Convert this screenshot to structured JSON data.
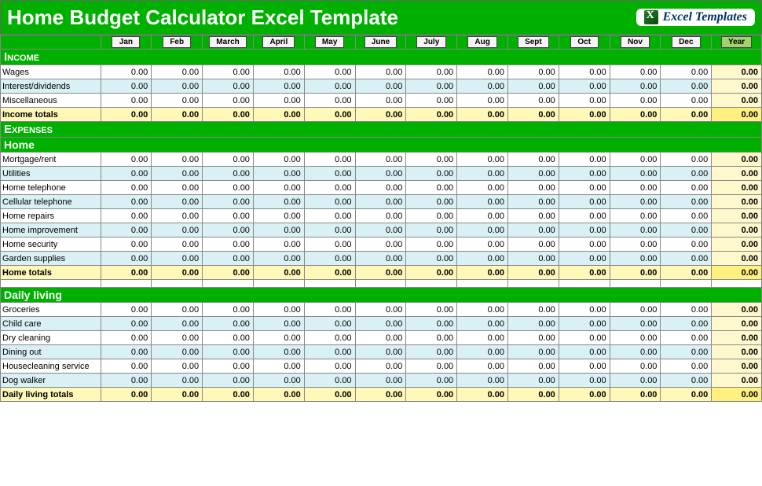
{
  "title": "Home Budget Calculator Excel Template",
  "logo_text": "Excel Templates",
  "months": [
    "Jan",
    "Feb",
    "March",
    "April",
    "May",
    "June",
    "July",
    "Aug",
    "Sept",
    "Oct",
    "Nov",
    "Dec"
  ],
  "year_label": "Year",
  "sections": {
    "income": {
      "header": "Income",
      "rows": [
        {
          "label": "Wages",
          "vals": [
            "0.00",
            "0.00",
            "0.00",
            "0.00",
            "0.00",
            "0.00",
            "0.00",
            "0.00",
            "0.00",
            "0.00",
            "0.00",
            "0.00"
          ],
          "year": "0.00"
        },
        {
          "label": "Interest/dividends",
          "vals": [
            "0.00",
            "0.00",
            "0.00",
            "0.00",
            "0.00",
            "0.00",
            "0.00",
            "0.00",
            "0.00",
            "0.00",
            "0.00",
            "0.00"
          ],
          "year": "0.00"
        },
        {
          "label": "Miscellaneous",
          "vals": [
            "0.00",
            "0.00",
            "0.00",
            "0.00",
            "0.00",
            "0.00",
            "0.00",
            "0.00",
            "0.00",
            "0.00",
            "0.00",
            "0.00"
          ],
          "year": "0.00"
        }
      ],
      "total": {
        "label": "Income totals",
        "vals": [
          "0.00",
          "0.00",
          "0.00",
          "0.00",
          "0.00",
          "0.00",
          "0.00",
          "0.00",
          "0.00",
          "0.00",
          "0.00",
          "0.00"
        ],
        "year": "0.00"
      }
    },
    "expenses": {
      "header": "Expenses"
    },
    "home": {
      "header": "Home",
      "rows": [
        {
          "label": "Mortgage/rent",
          "vals": [
            "0.00",
            "0.00",
            "0.00",
            "0.00",
            "0.00",
            "0.00",
            "0.00",
            "0.00",
            "0.00",
            "0.00",
            "0.00",
            "0.00"
          ],
          "year": "0.00"
        },
        {
          "label": "Utilities",
          "vals": [
            "0.00",
            "0.00",
            "0.00",
            "0.00",
            "0.00",
            "0.00",
            "0.00",
            "0.00",
            "0.00",
            "0.00",
            "0.00",
            "0.00"
          ],
          "year": "0.00"
        },
        {
          "label": "Home telephone",
          "vals": [
            "0.00",
            "0.00",
            "0.00",
            "0.00",
            "0.00",
            "0.00",
            "0.00",
            "0.00",
            "0.00",
            "0.00",
            "0.00",
            "0.00"
          ],
          "year": "0.00"
        },
        {
          "label": "Cellular telephone",
          "vals": [
            "0.00",
            "0.00",
            "0.00",
            "0.00",
            "0.00",
            "0.00",
            "0.00",
            "0.00",
            "0.00",
            "0.00",
            "0.00",
            "0.00"
          ],
          "year": "0.00"
        },
        {
          "label": "Home repairs",
          "vals": [
            "0.00",
            "0.00",
            "0.00",
            "0.00",
            "0.00",
            "0.00",
            "0.00",
            "0.00",
            "0.00",
            "0.00",
            "0.00",
            "0.00"
          ],
          "year": "0.00"
        },
        {
          "label": "Home improvement",
          "vals": [
            "0.00",
            "0.00",
            "0.00",
            "0.00",
            "0.00",
            "0.00",
            "0.00",
            "0.00",
            "0.00",
            "0.00",
            "0.00",
            "0.00"
          ],
          "year": "0.00"
        },
        {
          "label": "Home security",
          "vals": [
            "0.00",
            "0.00",
            "0.00",
            "0.00",
            "0.00",
            "0.00",
            "0.00",
            "0.00",
            "0.00",
            "0.00",
            "0.00",
            "0.00"
          ],
          "year": "0.00"
        },
        {
          "label": "Garden supplies",
          "vals": [
            "0.00",
            "0.00",
            "0.00",
            "0.00",
            "0.00",
            "0.00",
            "0.00",
            "0.00",
            "0.00",
            "0.00",
            "0.00",
            "0.00"
          ],
          "year": "0.00"
        }
      ],
      "total": {
        "label": "Home totals",
        "vals": [
          "0.00",
          "0.00",
          "0.00",
          "0.00",
          "0.00",
          "0.00",
          "0.00",
          "0.00",
          "0.00",
          "0.00",
          "0.00",
          "0.00"
        ],
        "year": "0.00"
      }
    },
    "daily": {
      "header": "Daily living",
      "rows": [
        {
          "label": "Groceries",
          "vals": [
            "0.00",
            "0.00",
            "0.00",
            "0.00",
            "0.00",
            "0.00",
            "0.00",
            "0.00",
            "0.00",
            "0.00",
            "0.00",
            "0.00"
          ],
          "year": "0.00"
        },
        {
          "label": "Child care",
          "vals": [
            "0.00",
            "0.00",
            "0.00",
            "0.00",
            "0.00",
            "0.00",
            "0.00",
            "0.00",
            "0.00",
            "0.00",
            "0.00",
            "0.00"
          ],
          "year": "0.00"
        },
        {
          "label": "Dry cleaning",
          "vals": [
            "0.00",
            "0.00",
            "0.00",
            "0.00",
            "0.00",
            "0.00",
            "0.00",
            "0.00",
            "0.00",
            "0.00",
            "0.00",
            "0.00"
          ],
          "year": "0.00"
        },
        {
          "label": "Dining out",
          "vals": [
            "0.00",
            "0.00",
            "0.00",
            "0.00",
            "0.00",
            "0.00",
            "0.00",
            "0.00",
            "0.00",
            "0.00",
            "0.00",
            "0.00"
          ],
          "year": "0.00"
        },
        {
          "label": "Housecleaning service",
          "vals": [
            "0.00",
            "0.00",
            "0.00",
            "0.00",
            "0.00",
            "0.00",
            "0.00",
            "0.00",
            "0.00",
            "0.00",
            "0.00",
            "0.00"
          ],
          "year": "0.00"
        },
        {
          "label": "Dog walker",
          "vals": [
            "0.00",
            "0.00",
            "0.00",
            "0.00",
            "0.00",
            "0.00",
            "0.00",
            "0.00",
            "0.00",
            "0.00",
            "0.00",
            "0.00"
          ],
          "year": "0.00"
        }
      ],
      "total": {
        "label": "Daily living totals",
        "vals": [
          "0.00",
          "0.00",
          "0.00",
          "0.00",
          "0.00",
          "0.00",
          "0.00",
          "0.00",
          "0.00",
          "0.00",
          "0.00",
          "0.00"
        ],
        "year": "0.00"
      }
    }
  }
}
